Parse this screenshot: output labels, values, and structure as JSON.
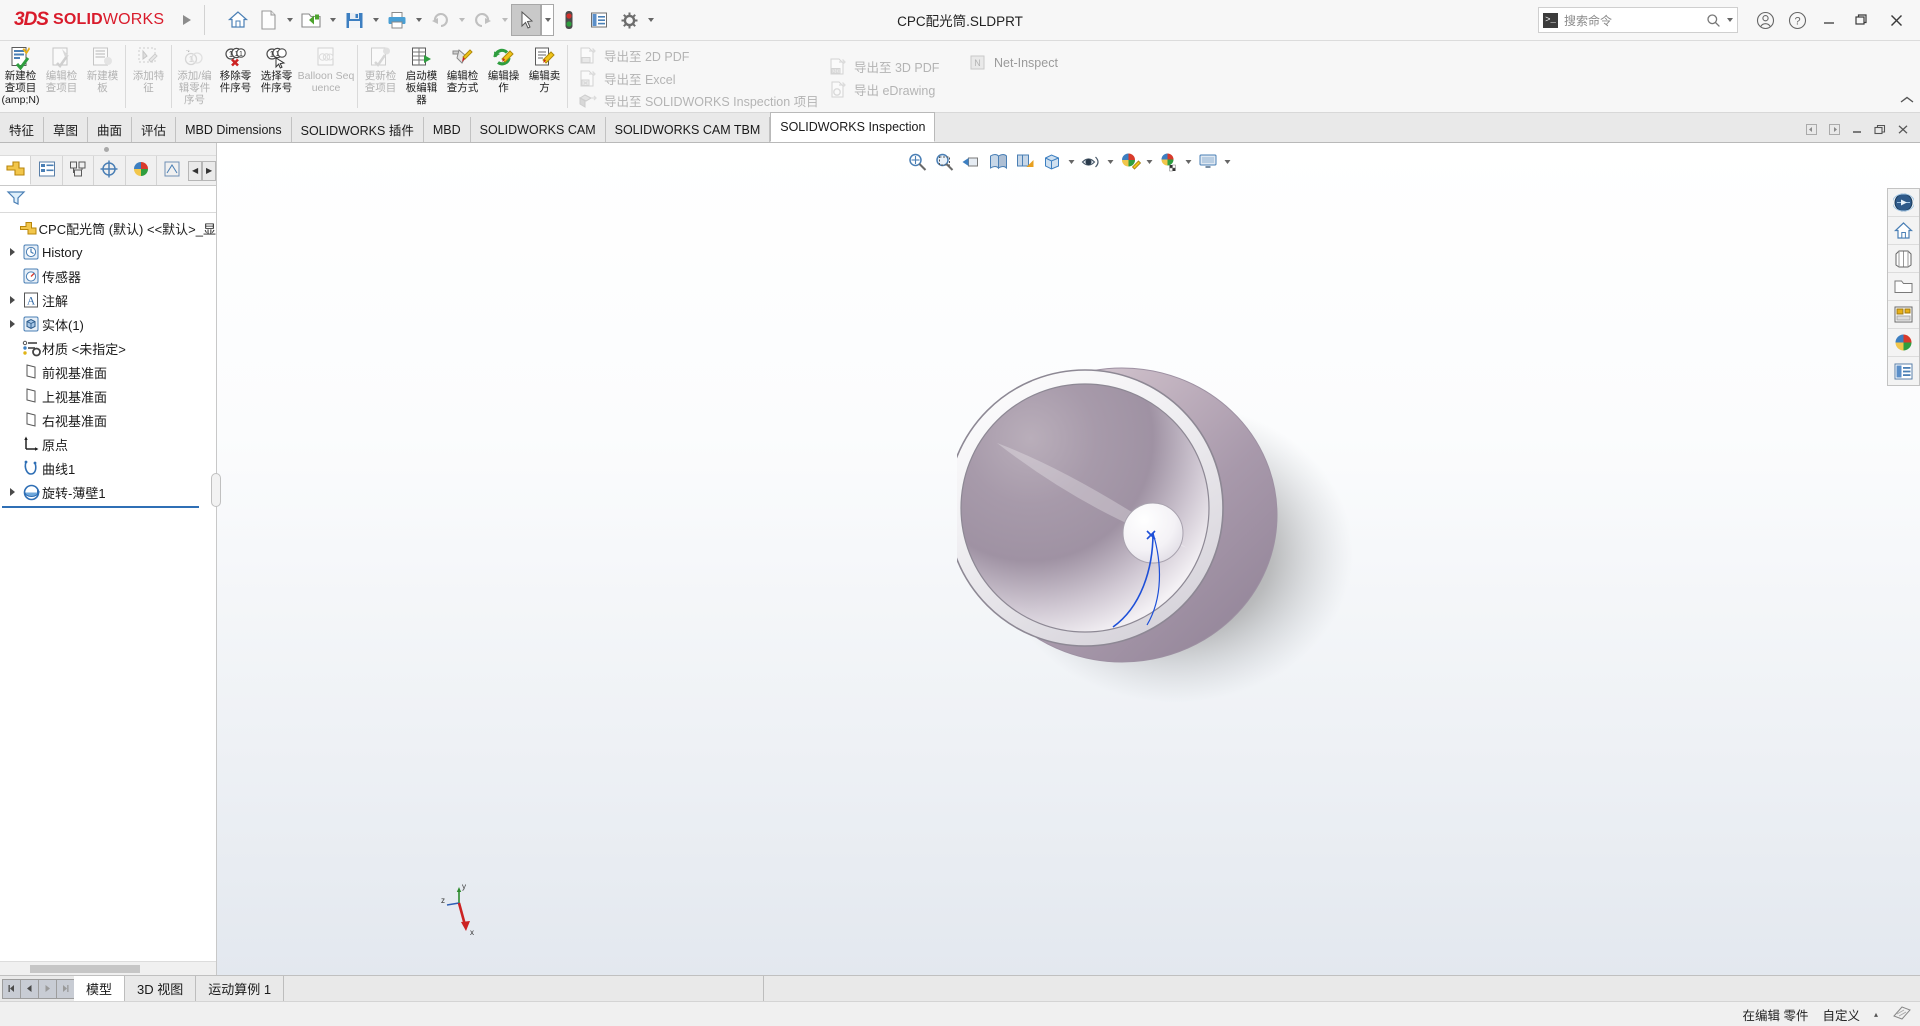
{
  "titlebar": {
    "brand_3ds": "3DS",
    "brand_bold": "SOLID",
    "brand_light": "WORKS",
    "document_title": "CPC配光筒.SLDPRT",
    "search": {
      "placeholder": "搜索命令",
      "prompt_icon": "command-prompt-icon"
    },
    "buttons": [
      {
        "name": "home-icon",
        "label": "主页"
      },
      {
        "name": "new-document-icon",
        "label": "新建"
      },
      {
        "name": "open-folder-icon",
        "label": "打开"
      },
      {
        "name": "save-icon",
        "label": "保存"
      },
      {
        "name": "print-icon",
        "label": "打印"
      },
      {
        "name": "undo-icon",
        "label": "撤销"
      },
      {
        "name": "redo-icon",
        "label": "重做"
      },
      {
        "name": "select-arrow-icon",
        "label": "选择"
      },
      {
        "name": "traffic-light-icon",
        "label": "重建模型"
      },
      {
        "name": "options-panel-icon",
        "label": "选项面板"
      },
      {
        "name": "gear-icon",
        "label": "选项"
      }
    ],
    "window_controls": [
      "account-icon",
      "help-icon",
      "minimize-icon",
      "restore-icon",
      "close-icon"
    ]
  },
  "ribbon": {
    "group1": [
      {
        "name": "new-inspection-project",
        "label": "新建检查项目 (amp;N)",
        "disabled": false,
        "icon": "new-inspection-icon"
      },
      {
        "name": "edit-inspection-project",
        "label": "编辑检查项目",
        "disabled": true,
        "icon": "edit-inspection-icon"
      },
      {
        "name": "new-template",
        "label": "新建模板",
        "disabled": true,
        "icon": "new-template-icon"
      },
      {
        "name": "add-feature",
        "label": "添加特征",
        "disabled": true,
        "icon": "add-feature-icon"
      }
    ],
    "group2": [
      {
        "name": "add-edit-balloon",
        "label": "添加/编辑零件序号",
        "disabled": true,
        "icon": "add-balloon-icon"
      },
      {
        "name": "remove-balloon",
        "label": "移除零件序号",
        "disabled": false,
        "icon": "remove-balloon-icon"
      },
      {
        "name": "select-balloon",
        "label": "选择零件序号",
        "disabled": false,
        "icon": "select-balloon-icon"
      },
      {
        "name": "balloon-sequence",
        "label": "Balloon Sequence",
        "disabled": true,
        "icon": "balloon-sequence-icon"
      }
    ],
    "group3": [
      {
        "name": "update-inspection-project",
        "label": "更新检查项目",
        "disabled": true,
        "icon": "update-inspection-icon"
      },
      {
        "name": "launch-template-editor",
        "label": "启动模板编辑器",
        "disabled": false,
        "icon": "template-editor-icon"
      },
      {
        "name": "edit-inspection-method",
        "label": "编辑检查方式",
        "disabled": false,
        "icon": "edit-method-icon"
      },
      {
        "name": "edit-operation",
        "label": "编辑操作",
        "disabled": false,
        "icon": "edit-operation-icon"
      },
      {
        "name": "edit-vendor",
        "label": "编辑卖方",
        "disabled": false,
        "icon": "edit-vendor-icon"
      }
    ],
    "export_col1": [
      {
        "name": "export-2d-pdf",
        "label": "导出至 2D PDF",
        "icon": "pdf-export-icon"
      },
      {
        "name": "export-excel",
        "label": "导出至 Excel",
        "icon": "excel-export-icon"
      },
      {
        "name": "export-inspection-project",
        "label": "导出至 SOLIDWORKS Inspection 项目",
        "icon": "inspection-export-icon"
      }
    ],
    "export_col2": [
      {
        "name": "export-3d-pdf",
        "label": "导出至 3D PDF",
        "icon": "pdf3d-export-icon"
      },
      {
        "name": "export-edrawing",
        "label": "导出 eDrawing",
        "icon": "edrawing-export-icon"
      }
    ],
    "export_col3": [
      {
        "name": "net-inspect",
        "label": "Net-Inspect",
        "icon": "net-inspect-icon"
      }
    ],
    "collapse_icon": "chevron-up-icon"
  },
  "tabbar": {
    "tabs": [
      {
        "name": "tab-features",
        "label": "特征",
        "active": false
      },
      {
        "name": "tab-sketch",
        "label": "草图",
        "active": false
      },
      {
        "name": "tab-surfaces",
        "label": "曲面",
        "active": false
      },
      {
        "name": "tab-evaluate",
        "label": "评估",
        "active": false
      },
      {
        "name": "tab-mbd-dimensions",
        "label": "MBD Dimensions",
        "active": false
      },
      {
        "name": "tab-solidworks-addins",
        "label": "SOLIDWORKS 插件",
        "active": false
      },
      {
        "name": "tab-mbd",
        "label": "MBD",
        "active": false
      },
      {
        "name": "tab-solidworks-cam",
        "label": "SOLIDWORKS CAM",
        "active": false
      },
      {
        "name": "tab-solidworks-cam-tbm",
        "label": "SOLIDWORKS CAM TBM",
        "active": false
      },
      {
        "name": "tab-solidworks-inspection",
        "label": "SOLIDWORKS Inspection",
        "active": true
      }
    ],
    "doc_window_controls": [
      "prev-doc-icon",
      "next-doc-icon",
      "doc-minimize-icon",
      "doc-restore-icon",
      "doc-close-icon"
    ]
  },
  "feature_manager": {
    "tabs": [
      {
        "name": "fm-tab-feature-tree",
        "icon": "feature-tree-icon",
        "active": true
      },
      {
        "name": "fm-tab-property-manager",
        "icon": "property-manager-icon",
        "active": false
      },
      {
        "name": "fm-tab-configuration-manager",
        "icon": "configuration-manager-icon",
        "active": false
      },
      {
        "name": "fm-tab-dimxpert-manager",
        "icon": "dimxpert-icon",
        "active": false
      },
      {
        "name": "fm-tab-display-manager",
        "icon": "display-manager-icon",
        "active": false
      },
      {
        "name": "fm-tab-more",
        "icon": "more-tab-icon",
        "active": false
      }
    ],
    "filter_icon": "filter-funnel-icon",
    "filter_placeholder": "",
    "tree": [
      {
        "name": "tree-root",
        "label": "CPC配光筒 (默认) <<默认>_显",
        "icon": "part-icon",
        "expandable": false,
        "indent": 0
      },
      {
        "name": "tree-history",
        "label": "History",
        "icon": "history-icon",
        "expandable": true,
        "indent": 1
      },
      {
        "name": "tree-sensors",
        "label": "传感器",
        "icon": "sensor-icon",
        "expandable": false,
        "indent": 1
      },
      {
        "name": "tree-annotations",
        "label": "注解",
        "icon": "annotation-icon",
        "expandable": true,
        "indent": 1
      },
      {
        "name": "tree-solid-bodies",
        "label": "实体(1)",
        "icon": "solid-body-icon",
        "expandable": true,
        "indent": 1
      },
      {
        "name": "tree-material",
        "label": "材质 <未指定>",
        "icon": "material-icon",
        "expandable": false,
        "indent": 1
      },
      {
        "name": "tree-front-plane",
        "label": "前视基准面",
        "icon": "plane-icon",
        "expandable": false,
        "indent": 1
      },
      {
        "name": "tree-top-plane",
        "label": "上视基准面",
        "icon": "plane-icon",
        "expandable": false,
        "indent": 1
      },
      {
        "name": "tree-right-plane",
        "label": "右视基准面",
        "icon": "plane-icon",
        "expandable": false,
        "indent": 1
      },
      {
        "name": "tree-origin",
        "label": "原点",
        "icon": "origin-icon",
        "expandable": false,
        "indent": 1
      },
      {
        "name": "tree-curve1",
        "label": "曲线1",
        "icon": "curve-icon",
        "expandable": false,
        "indent": 1
      },
      {
        "name": "tree-revolve-thin1",
        "label": "旋转-薄壁1",
        "icon": "revolve-icon",
        "expandable": true,
        "indent": 1
      }
    ]
  },
  "view_toolbar": [
    {
      "name": "zoom-to-fit-icon",
      "label": "整屏显示全图"
    },
    {
      "name": "zoom-to-area-icon",
      "label": "局部放大"
    },
    {
      "name": "previous-view-icon",
      "label": "上一视图"
    },
    {
      "name": "section-view-icon",
      "label": "剖面视图"
    },
    {
      "name": "view-orientation-icon",
      "label": "视图定向"
    },
    {
      "name": "display-style-icon",
      "label": "显示样式",
      "has_caret": true
    },
    {
      "name": "hide-show-items-icon",
      "label": "隐藏/显示项目",
      "has_caret": true
    },
    {
      "name": "edit-appearance-icon",
      "label": "编辑外观",
      "has_caret": true
    },
    {
      "name": "apply-scene-icon",
      "label": "应用布景",
      "has_caret": true
    },
    {
      "name": "view-settings-icon",
      "label": "视图设定",
      "has_caret": true
    }
  ],
  "right_toolbar": [
    {
      "name": "view-navigator-icon",
      "label": "视图导航"
    },
    {
      "name": "home-view-icon",
      "label": "主视图"
    },
    {
      "name": "view-palette-icon",
      "label": "视图调色板"
    },
    {
      "name": "appearances-folder-icon",
      "label": "外观、布景和贴图"
    },
    {
      "name": "custom-properties-icon",
      "label": "自定义属性"
    },
    {
      "name": "display-manager-sphere-icon",
      "label": "显示管理器"
    },
    {
      "name": "task-pane-list-icon",
      "label": "任务窗格"
    }
  ],
  "triad": {
    "x_label": "x",
    "y_label": "y",
    "z_label": "z"
  },
  "bottom": {
    "nav_buttons": [
      "first-tab-icon",
      "prev-tab-icon",
      "next-tab-icon",
      "last-tab-icon"
    ],
    "tabs": [
      {
        "name": "bottom-tab-model",
        "label": "模型",
        "active": true
      },
      {
        "name": "bottom-tab-3d-views",
        "label": "3D 视图",
        "active": false
      },
      {
        "name": "bottom-tab-motion-study",
        "label": "运动算例 1",
        "active": false
      }
    ]
  },
  "status_bar": {
    "editing_state": "在编辑 零件",
    "custom": "自定义",
    "caret": "▴",
    "overlay_icon": "status-overlay-icon"
  }
}
